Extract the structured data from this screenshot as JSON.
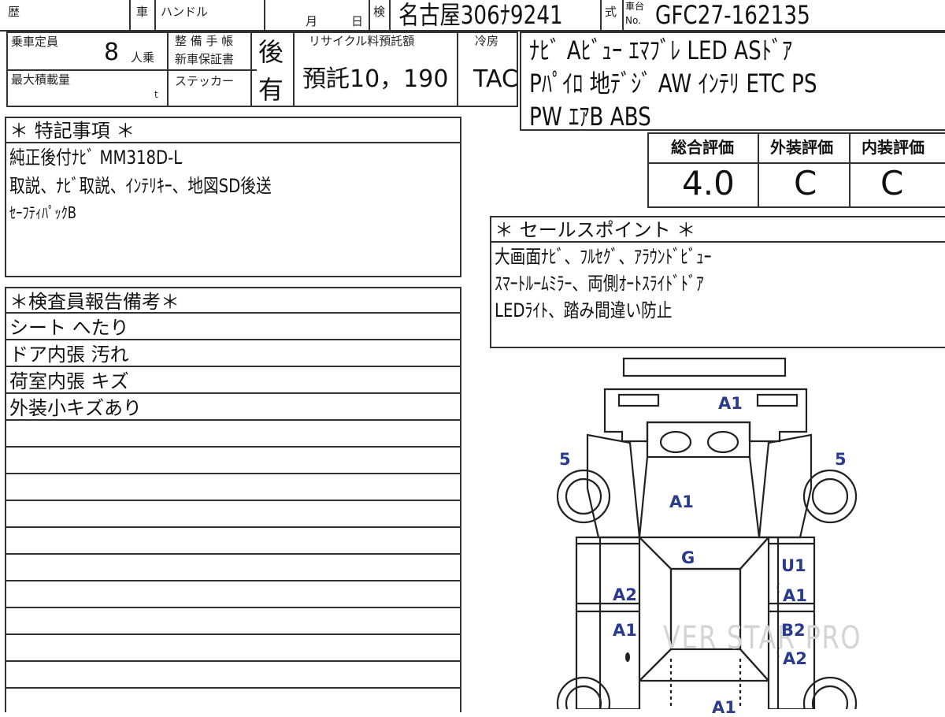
{
  "header": {
    "history_label": "歴",
    "car_label": "車",
    "handle_label": "ハンドル",
    "month_label": "月",
    "day_label": "日",
    "inspection_label": "検",
    "plate": "名古屋306ﾅ9241",
    "model_label": "式",
    "chassis_label_top": "車台",
    "chassis_label_bottom": "No.",
    "chassis_no": "GFC27-162135"
  },
  "capacity": {
    "label": "乗車定員",
    "value": "8",
    "unit": "人乗"
  },
  "max_load": {
    "label": "最大積載量",
    "unit": "t"
  },
  "manual": {
    "label_line1": "整 備 手 帳",
    "label_line2": "新車保証書",
    "value": "後",
    "sticker_label": "ステッカー",
    "sticker_value": "有"
  },
  "recycle": {
    "label": "リサイクル料預託額",
    "value": "預託10，190"
  },
  "aircon": {
    "label": "冷房",
    "value": "TAC"
  },
  "equipment": {
    "lines": [
      "ﾅﾋﾞ Aﾋﾞｭｰ ｴﾏﾌﾞﾚ LED ASﾄﾞｱ",
      "Pﾊﾟｲﾛ 地ﾃﾞｼﾞ AW ｲﾝﾃﾘ ETC PS",
      "PW ｴｱB ABS"
    ]
  },
  "scores": {
    "overall_label": "総合評価",
    "overall": "4.0",
    "exterior_label": "外装評価",
    "exterior": "C",
    "interior_label": "内装評価",
    "interior": "C"
  },
  "special_notes": {
    "title": "＊ 特記事項 ＊",
    "lines": [
      "純正後付ﾅﾋﾞ MM318D-L",
      "取説、ﾅﾋﾞ取説、ｲﾝﾃﾘｷｰ、地図SD後送",
      "ｾｰﾌﾃｨﾊﾟｯｸB"
    ]
  },
  "sales_points": {
    "title": "＊ セールスポイント ＊",
    "lines": [
      "大画面ﾅﾋﾞ、ﾌﾙｾｸﾞ、ｱﾗｳﾝﾄﾞﾋﾞｭｰ",
      "ｽﾏｰﾄﾙｰﾑﾐﾗｰ、両側ｵｰﾄｽﾗｲﾄﾞﾄﾞｱ",
      "LEDﾗｲﾄ、踏み間違い防止"
    ]
  },
  "inspector_notes": {
    "title": "＊検査員報告備考＊",
    "lines": [
      "シート へたり",
      "ドア内張 汚れ",
      "荷室内張 キズ",
      "外装小キズあり"
    ]
  },
  "damage_codes": {
    "front_bumper": "A1",
    "front_left_tire": "5",
    "front_right_tire": "5",
    "hood": "A1",
    "windshield": "G",
    "right_front_door_1": "U1",
    "right_front_door_2": "A1",
    "left_front_door": "A2",
    "left_rear_door": "A1",
    "right_rear_door_1": "B2",
    "right_rear_door_2": "A2",
    "roof_rear": "A1"
  },
  "watermark": "VER STAR PRO"
}
